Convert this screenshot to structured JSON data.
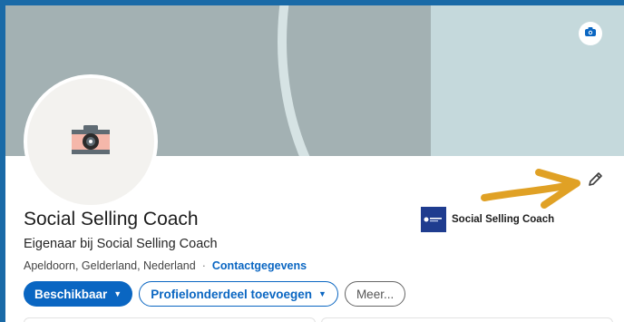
{
  "profile": {
    "name": "Social Selling Coach",
    "headline": "Eigenaar bij Social Selling Coach",
    "location": "Apeldoorn, Gelderland, Nederland",
    "separator": "·",
    "contact_link": "Contactgegevens"
  },
  "company": {
    "name": "Social Selling Coach"
  },
  "actions": {
    "available_label": "Beschikbaar",
    "add_section_label": "Profielonderdeel toevoegen",
    "more_label": "Meer..."
  },
  "icons": {
    "banner_camera": "camera-icon",
    "avatar_camera": "camera-icon",
    "edit": "pencil-icon",
    "annotation": "arrow-icon",
    "caret": "caret-down-icon"
  },
  "colors": {
    "accent": "#0a66c2",
    "frame": "#1a6aa7",
    "arrow": "#e0a125",
    "banner": "#a3b1b3"
  }
}
